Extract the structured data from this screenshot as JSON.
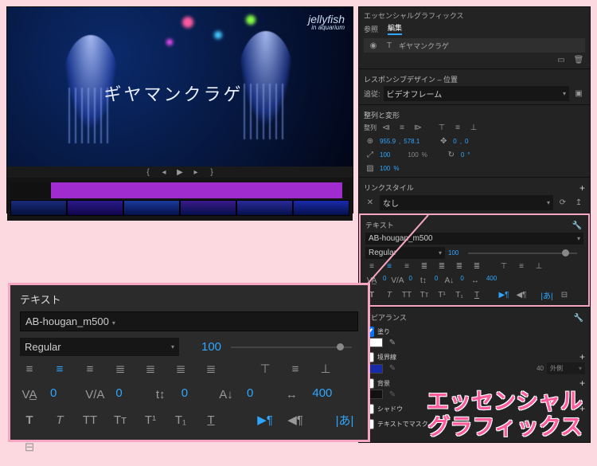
{
  "preview": {
    "overlay_text": "ギヤマンクラゲ",
    "watermark_title": "jellyfish",
    "watermark_sub": "in aquarium"
  },
  "panel": {
    "title": "エッセンシャルグラフィックス",
    "tabs": {
      "browse": "参照",
      "edit": "編集"
    },
    "layer_name": "ギヤマンクラゲ",
    "responsive": {
      "header": "レスポンシブデザイン – 位置",
      "pin_label": "追従:",
      "pin_value": "ビデオフレーム"
    },
    "align": {
      "header": "整列と変形",
      "group_label": "整列",
      "pos_x": "955.9",
      "pos_y": "578.1",
      "anchor_x": "0",
      "anchor_y": "0",
      "scale": "100",
      "scale_pct": "100",
      "rotation": "0",
      "opacity": "100"
    },
    "linkstyle": {
      "header": "リンクスタイル",
      "value": "なし"
    },
    "text": {
      "header": "テキスト",
      "font": "AB-hougan_m500",
      "style": "Regular",
      "size": "100",
      "kerning": "0",
      "tracking_va": "0",
      "leading": "0",
      "tsume": "0",
      "width": "400"
    },
    "appearance": {
      "header": "アピアランス",
      "fill": {
        "label": "塗り",
        "color": "#ffffff"
      },
      "stroke": {
        "label": "境界線",
        "color": "#1030ff",
        "width": "40"
      },
      "bg": {
        "label": "背景"
      },
      "shadow": {
        "label": "シャドウ"
      },
      "mask": {
        "label": "テキストでマスク"
      }
    }
  },
  "overlay_title": {
    "line1": "エッセンシャル",
    "line2": "グラフィックス"
  }
}
